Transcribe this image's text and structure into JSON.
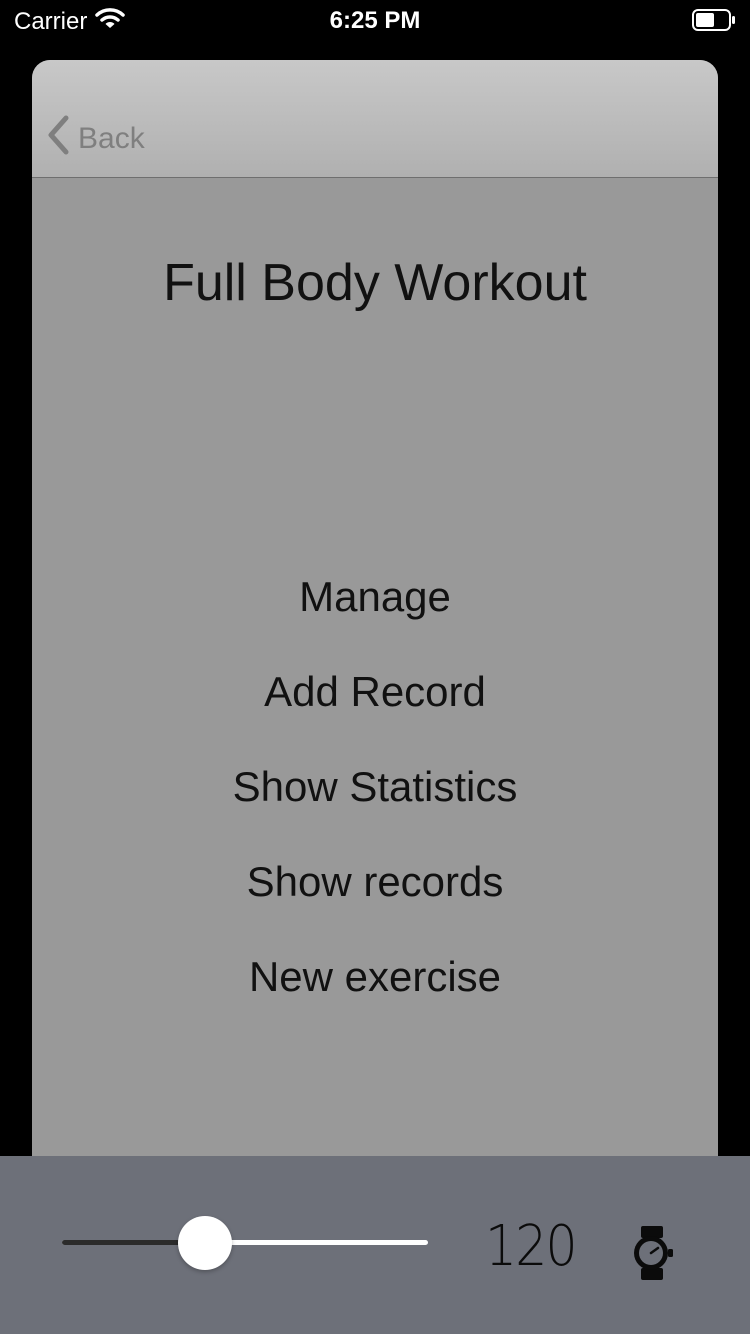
{
  "status_bar": {
    "carrier": "Carrier",
    "time": "6:25 PM",
    "icons": [
      "wifi-icon",
      "battery-icon"
    ]
  },
  "nav": {
    "back_label": "Back",
    "back_icon": "chevron-left-icon"
  },
  "page": {
    "title": "Full Body Workout"
  },
  "menu": {
    "items": [
      {
        "label": "Manage"
      },
      {
        "label": "Add Record"
      },
      {
        "label": "Show Statistics"
      },
      {
        "label": "Show records"
      },
      {
        "label": "New exercise"
      }
    ]
  },
  "bottom_bar": {
    "slider_fraction": 0.39,
    "timer_value": "120",
    "watch_icon": "stopwatch-icon"
  },
  "colors": {
    "card_background": "#999999",
    "nav_background": "#c0c0c0",
    "bottom_bar_background": "#6d7079",
    "back_color": "#7f7f7f",
    "text_color": "#111111"
  }
}
